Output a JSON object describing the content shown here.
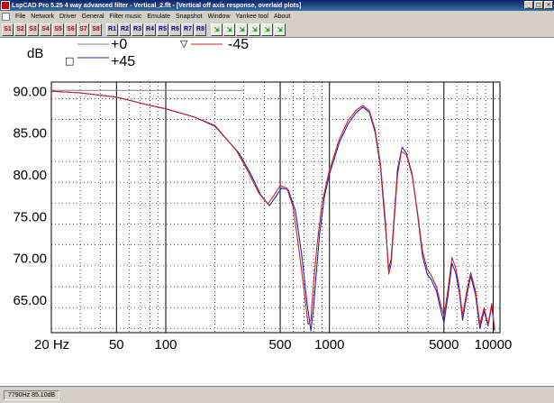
{
  "window": {
    "title": "LspCAD Pro 5.25 4 way advanced filter - Vertical_2.flt - [Vertical off axis response, overlaid plots]",
    "buttons": {
      "minimize": "_",
      "maximize": "□",
      "close": "×"
    }
  },
  "menu": [
    "File",
    "Network",
    "Driver",
    "General",
    "Filter music",
    "Emulate",
    "Snapshot",
    "Window",
    "Yankee tool",
    "About"
  ],
  "toolbar": {
    "s_buttons": [
      "S1",
      "S2",
      "S3",
      "S4",
      "S5",
      "S6",
      "S7",
      "S8"
    ],
    "r_buttons": [
      "R1",
      "R2",
      "R3",
      "R4",
      "R5",
      "R6",
      "R7",
      "R8"
    ],
    "tool_icons": [
      "chart-tool-1-icon",
      "chart-tool-2-icon",
      "chart-tool-3-icon",
      "chart-tool-4-icon",
      "chart-tool-5-icon",
      "chart-tool-6-icon"
    ]
  },
  "status": {
    "text": "7790Hz 85.10dB"
  },
  "colors": {
    "grey_series": "#808080",
    "blue_series": "#2020c0",
    "red_series": "#d02020",
    "grid": "#000000"
  },
  "chart_data": {
    "type": "line",
    "title": "",
    "xlabel": "",
    "ylabel": "dB",
    "x_scale": "log",
    "xlim": [
      20,
      11000
    ],
    "ylim": [
      61,
      91
    ],
    "grid": true,
    "x_tick_labels": [
      {
        "value": 20,
        "label": "20 Hz"
      },
      {
        "value": 50,
        "label": "50"
      },
      {
        "value": 100,
        "label": "100"
      },
      {
        "value": 500,
        "label": "500"
      },
      {
        "value": 1000,
        "label": "1000"
      },
      {
        "value": 5000,
        "label": "5000"
      },
      {
        "value": 10000,
        "label": "10000"
      }
    ],
    "y_tick_labels": [
      {
        "value": 90,
        "label": "90.00"
      },
      {
        "value": 85,
        "label": "85.00"
      },
      {
        "value": 80,
        "label": "80.00"
      },
      {
        "value": 75,
        "label": "75.00"
      },
      {
        "value": 70,
        "label": "70.00"
      },
      {
        "value": 65,
        "label": "65.00"
      }
    ],
    "legend": [
      {
        "name": "+0",
        "color": "#808080",
        "marker": ""
      },
      {
        "name": "-45",
        "color": "#d02020",
        "marker": "▽"
      },
      {
        "name": "+45",
        "color": "#2020c0",
        "marker": "□"
      }
    ],
    "series": [
      {
        "name": "+0",
        "color": "#808080",
        "x": [
          20,
          300
        ],
        "y": [
          90,
          90
        ]
      },
      {
        "name": "+45",
        "color": "#2020c0",
        "x": [
          20,
          30,
          50,
          80,
          100,
          150,
          200,
          280,
          330,
          380,
          430,
          470,
          510,
          560,
          620,
          680,
          730,
          770,
          800,
          830,
          870,
          930,
          1000,
          1150,
          1300,
          1450,
          1600,
          1750,
          1900,
          2050,
          2200,
          2300,
          2380,
          2480,
          2600,
          2780,
          2950,
          3200,
          3450,
          3700,
          3950,
          4200,
          4500,
          4750,
          5000,
          5300,
          5600,
          5900,
          6200,
          6500,
          6900,
          7300,
          7800,
          8300,
          8800,
          9300,
          9800,
          10200
        ],
        "y": [
          89.9,
          89.7,
          89.2,
          88.2,
          87.8,
          86.8,
          85.7,
          82.5,
          80.0,
          77.5,
          76.2,
          77.3,
          78.3,
          78.1,
          75.6,
          70.0,
          64.5,
          61.2,
          64.0,
          68.0,
          72.8,
          77.2,
          80.0,
          83.8,
          86.0,
          87.3,
          88.0,
          87.4,
          85.0,
          80.8,
          73.5,
          68.6,
          69.8,
          74.5,
          80.5,
          83.2,
          82.5,
          80.0,
          75.2,
          70.2,
          68.0,
          67.3,
          66.0,
          64.0,
          62.2,
          65.5,
          69.3,
          68.2,
          66.0,
          62.5,
          65.5,
          67.8,
          65.5,
          61.5,
          63.6,
          61.8,
          64.2,
          61.2
        ]
      },
      {
        "name": "-45",
        "color": "#d02020",
        "x": [
          20,
          30,
          50,
          80,
          100,
          150,
          200,
          270,
          320,
          370,
          420,
          460,
          500,
          550,
          600,
          650,
          700,
          740,
          770,
          800,
          840,
          900,
          1000,
          1150,
          1300,
          1450,
          1600,
          1750,
          1900,
          2050,
          2200,
          2300,
          2380,
          2480,
          2600,
          2750,
          2950,
          3200,
          3450,
          3700,
          3950,
          4200,
          4500,
          4750,
          5000,
          5300,
          5600,
          5900,
          6200,
          6500,
          6900,
          7300,
          7800,
          8300,
          8800,
          9300,
          9800,
          10200
        ],
        "y": [
          89.9,
          89.7,
          89.2,
          88.2,
          87.8,
          86.8,
          85.8,
          82.8,
          80.2,
          77.7,
          76.4,
          77.5,
          78.6,
          78.3,
          76.0,
          71.0,
          66.0,
          62.0,
          62.5,
          67.0,
          71.5,
          76.5,
          80.5,
          84.2,
          86.4,
          87.6,
          88.2,
          87.6,
          85.3,
          81.2,
          74.2,
          68.0,
          69.2,
          74.0,
          79.8,
          82.7,
          82.3,
          79.8,
          75.4,
          70.8,
          68.6,
          67.8,
          66.5,
          64.6,
          63.0,
          66.2,
          70.0,
          68.8,
          66.5,
          63.0,
          66.0,
          68.2,
          66.0,
          62.0,
          64.0,
          62.0,
          64.5,
          61.5
        ]
      }
    ]
  }
}
